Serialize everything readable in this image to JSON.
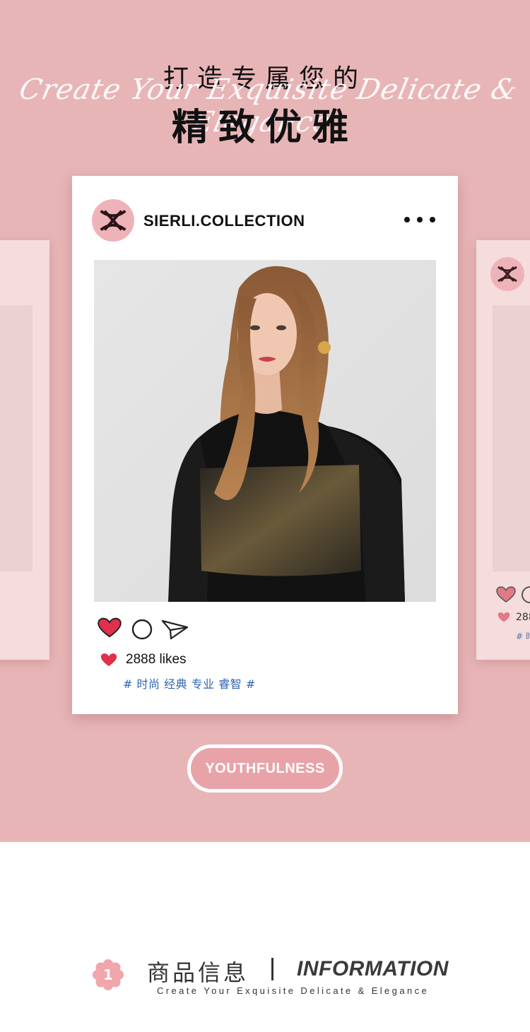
{
  "header": {
    "title_line1": "打造专属您的",
    "title_script": "Create Your Exquisite Delicate & Elegance",
    "title_line2": "精致优雅"
  },
  "post": {
    "account_name": "SIERLI.COLLECTION",
    "more_icon": "more-horizontal-icon",
    "likes": "2888 likes",
    "tags": "# 时尚 经典 专业 睿智 #",
    "icons": [
      "heart-icon",
      "comment-icon",
      "share-icon"
    ],
    "colors": {
      "heart": "#e0304a",
      "tags": "#2f64b0"
    }
  },
  "side_card_right": {
    "likes": "288",
    "tags": "# 时"
  },
  "badge": {
    "label": "YOUTHFULNESS"
  },
  "info_section": {
    "number": "1",
    "title_cn": "商品信息",
    "title_en": "INFORMATION",
    "subtitle": "Create Your Exquisite Delicate & Elegance"
  },
  "colors": {
    "background_pink": "#e8b5b7",
    "card": "#ffffff",
    "accent_pink": "#eeb3b8"
  }
}
